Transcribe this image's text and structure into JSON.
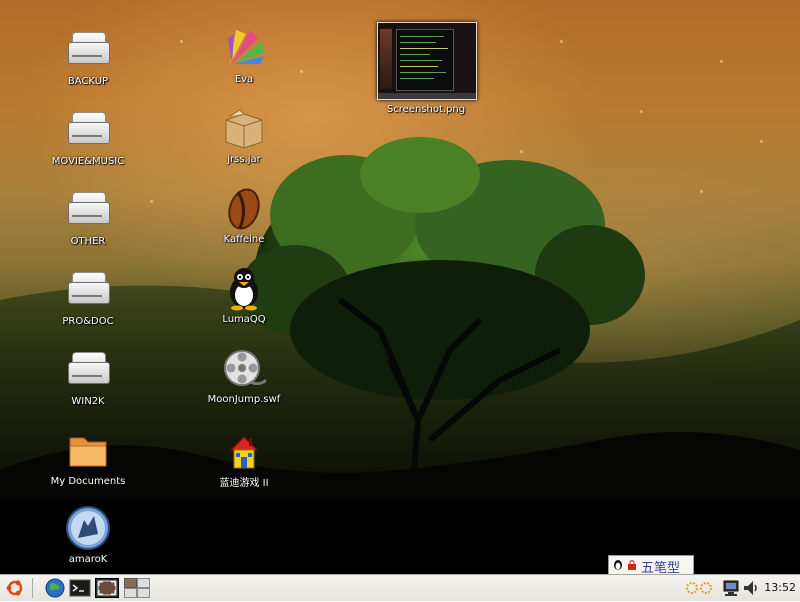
{
  "desktop": {
    "icons_left": [
      {
        "label": "BACKUP",
        "type": "drive-icon"
      },
      {
        "label": "MOVIE&MUSIC",
        "type": "drive-icon"
      },
      {
        "label": "OTHER",
        "type": "drive-icon"
      },
      {
        "label": "PRO&DOC",
        "type": "drive-icon"
      },
      {
        "label": "WIN2K",
        "type": "drive-icon"
      },
      {
        "label": "My Documents",
        "type": "folder-icon"
      },
      {
        "label": "amaroK",
        "type": "amarok-wolf-icon"
      }
    ],
    "icons_middle": [
      {
        "label": "Eva",
        "type": "eva-fan-icon"
      },
      {
        "label": "jrss.jar",
        "type": "package-box-icon"
      },
      {
        "label": "Kaffeine",
        "type": "coffee-bean-icon"
      },
      {
        "label": "LumaQQ",
        "type": "penguin-icon"
      },
      {
        "label": "MoonJump.swf",
        "type": "film-reel-icon"
      },
      {
        "label": "蓝迪游戏 II",
        "type": "house-icon"
      }
    ],
    "icon_right": {
      "label": "Screenshot.png",
      "type": "image-thumbnail-icon"
    }
  },
  "ime_bar": {
    "text": "五笔型"
  },
  "taskbar": {
    "launchers": [
      "ubuntu-logo-icon",
      "web-browser-globe-icon",
      "terminal-icon",
      "screenshot-app-icon",
      "workspace-switcher-icon"
    ],
    "tray": [
      "input-method-icon",
      "network-monitor-icon",
      "volume-icon"
    ],
    "clock": "13:52"
  },
  "colors": {
    "taskbar_bg": "#e6e4dc",
    "label_text": "#ffffff",
    "ime_text": "#36459a"
  }
}
